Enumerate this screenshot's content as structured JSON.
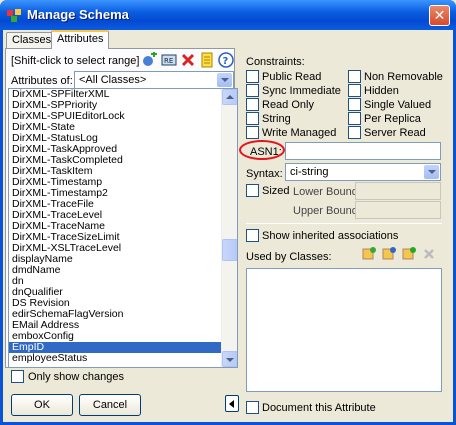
{
  "window": {
    "title": "Manage Schema",
    "close_glyph": "✕"
  },
  "tabs": [
    {
      "label": "Classes"
    },
    {
      "label": "Attributes"
    }
  ],
  "left": {
    "hint": "[Shift-click to select range]",
    "attributes_of_label": "Attributes of:",
    "attributes_of_value": "<All Classes>",
    "toolbar_icons": [
      "add-attribute-icon",
      "rename-icon",
      "delete-icon",
      "refresh-icon",
      "notes-icon",
      "help-icon"
    ],
    "items": [
      "DirXML-SPFilterXML",
      "DirXML-SPPriority",
      "DirXML-SPUIEditorLock",
      "DirXML-State",
      "DirXML-StatusLog",
      "DirXML-TaskApproved",
      "DirXML-TaskCompleted",
      "DirXML-TaskItem",
      "DirXML-Timestamp",
      "DirXML-Timestamp2",
      "DirXML-TraceFile",
      "DirXML-TraceLevel",
      "DirXML-TraceName",
      "DirXML-TraceSizeLimit",
      "DirXML-XSLTraceLevel",
      "displayName",
      "dmdName",
      "dn",
      "dnQualifier",
      "DS Revision",
      "edirSchemaFlagVersion",
      "EMail Address",
      "emboxConfig",
      "EmpID",
      "employeeStatus"
    ],
    "selected_item": "EmpID",
    "only_show_changes": "Only show changes",
    "ok_label": "OK",
    "cancel_label": "Cancel"
  },
  "right": {
    "constraints_label": "Constraints:",
    "constraints": [
      {
        "label": "Public Read"
      },
      {
        "label": "Non Removable"
      },
      {
        "label": "Sync Immediate"
      },
      {
        "label": "Hidden"
      },
      {
        "label": "Read Only"
      },
      {
        "label": "Single Valued"
      },
      {
        "label": "String"
      },
      {
        "label": "Per Replica"
      },
      {
        "label": "Write Managed"
      },
      {
        "label": "Server Read"
      }
    ],
    "asn1_label": "ASN1:",
    "asn1_value": "",
    "syntax_label": "Syntax:",
    "syntax_value": "ci-string",
    "sized_label": "Sized",
    "lower_bound_label": "Lower Bound:",
    "upper_bound_label": "Upper Bound:",
    "show_inherited": "Show inherited associations",
    "used_by_label": "Used by Classes:",
    "used_by_icons": [
      "add-class-icon",
      "add-class-2-icon",
      "add-class-3-icon",
      "remove-class-icon"
    ],
    "document_attribute": "Document this Attribute"
  },
  "colors": {
    "accent": "#0a52d6",
    "selection": "#316ac5",
    "highlight_circle": "#e3141b"
  }
}
